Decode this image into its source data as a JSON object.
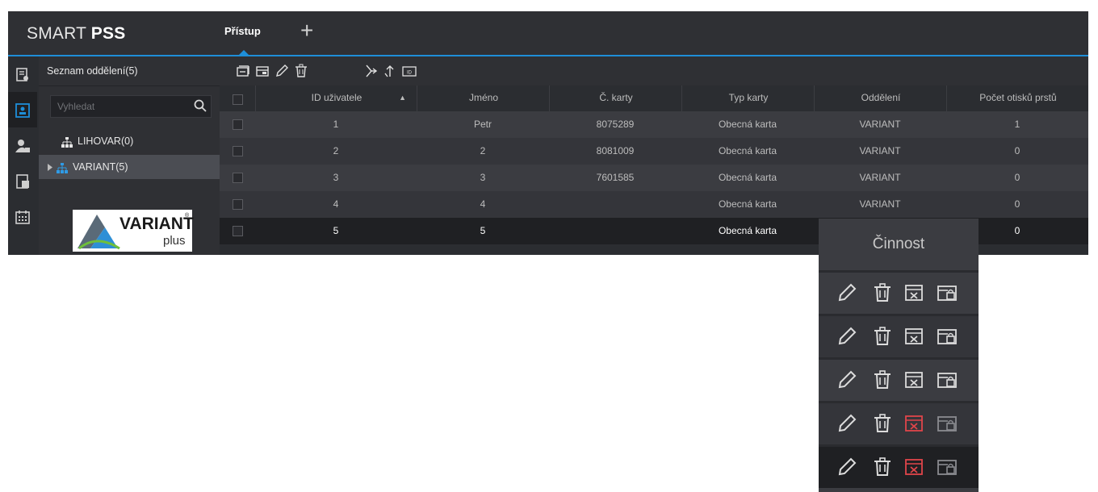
{
  "app": {
    "logo_light": "SMART ",
    "logo_bold": "PSS",
    "active_tab": "Přístup",
    "add_tab_glyph": "+"
  },
  "sidebar": {
    "icons": [
      "user-record-icon",
      "access-card-icon",
      "user-lock-icon",
      "door-icon",
      "calendar-icon"
    ]
  },
  "tree": {
    "title": "Seznam oddělení(5)",
    "search_placeholder": "Vyhledat",
    "nodes": [
      {
        "label": "LIHOVAR(0)",
        "expandable": false,
        "selected": false
      },
      {
        "label": "VARIANT(5)",
        "expandable": true,
        "selected": true
      }
    ],
    "brand_logo": {
      "text": "VARIANT",
      "sub": "plus",
      "registered": "®"
    }
  },
  "toolbar": {
    "icons": [
      "add-user-icon",
      "add-card-icon",
      "edit-icon",
      "delete-icon",
      "import-icon",
      "export-icon",
      "id-card-icon"
    ]
  },
  "table": {
    "columns": [
      "",
      "ID uživatele",
      "Jméno",
      "Č. karty",
      "Typ karty",
      "Oddělení",
      "Počet otisků prstů"
    ],
    "sort_indicator": "▲",
    "rows": [
      [
        "1",
        "Petr",
        "8075289",
        "Obecná karta",
        "VARIANT",
        "1"
      ],
      [
        "2",
        "2",
        "8081009",
        "Obecná karta",
        "VARIANT",
        "0"
      ],
      [
        "3",
        "3",
        "7601585",
        "Obecná karta",
        "VARIANT",
        "0"
      ],
      [
        "4",
        "4",
        "",
        "Obecná karta",
        "VARIANT",
        "0"
      ],
      [
        "5",
        "5",
        "",
        "Obecná karta",
        "",
        "0"
      ]
    ]
  },
  "actions": {
    "title": "Činnost",
    "rows": [
      {
        "card_icon_color": "#dcdcdc",
        "lock_icon_color": "#dcdcdc"
      },
      {
        "card_icon_color": "#dcdcdc",
        "lock_icon_color": "#dcdcdc"
      },
      {
        "card_icon_color": "#dcdcdc",
        "lock_icon_color": "#dcdcdc"
      },
      {
        "card_icon_color": "#e0454a",
        "lock_icon_color": "#8a8b90"
      },
      {
        "card_icon_color": "#e0454a",
        "lock_icon_color": "#8a8b90"
      }
    ]
  },
  "colors": {
    "accent": "#1e8ed8",
    "danger": "#e0454a"
  }
}
